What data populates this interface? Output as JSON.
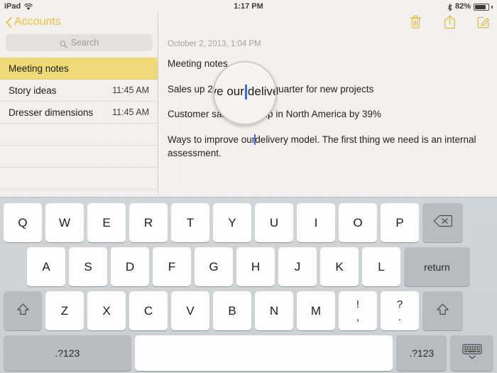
{
  "status_bar": {
    "device": "iPad",
    "wifi_icon": "wifi-icon",
    "time": "1:17 PM",
    "bluetooth_icon": "bluetooth-icon",
    "battery_percent": "82%",
    "battery_icon": "battery-icon"
  },
  "sidebar": {
    "back_label": "Accounts",
    "back_chevron_icon": "chevron-left-icon",
    "search": {
      "icon": "search-icon",
      "placeholder": "Search",
      "value": ""
    },
    "notes": [
      {
        "title": "Meeting notes",
        "time": "",
        "selected": true
      },
      {
        "title": "Story ideas",
        "time": "11:45 AM",
        "selected": false
      },
      {
        "title": "Dresser dimensions",
        "time": "11:45 AM",
        "selected": false
      }
    ],
    "empty_rows": 4
  },
  "note": {
    "toolbar": {
      "trash_icon": "trash-icon",
      "share_icon": "share-icon",
      "compose_icon": "compose-icon"
    },
    "date": "October 2, 2013, 1:04 PM",
    "title_line": "Meeting notes",
    "paragraphs": [
      "Sales up 20 percent this quarter for new projects",
      "Customer satisfaction up in North America by 39%",
      "Ways to improve our delivery model.  The first thing we need is an internal assessment."
    ],
    "body_line3_before_caret": "Ways to improve our",
    "body_line3_after_caret": "delivery model.  The first thing we need is an internal assessment.",
    "caret_color": "#3a6fe0"
  },
  "magnifier": {
    "text_before_caret": "ve our",
    "text_after_caret": "delive"
  },
  "keyboard": {
    "row1": [
      {
        "label": "Q",
        "type": "letter"
      },
      {
        "label": "W",
        "type": "letter"
      },
      {
        "label": "E",
        "type": "letter"
      },
      {
        "label": "R",
        "type": "letter"
      },
      {
        "label": "T",
        "type": "letter"
      },
      {
        "label": "Y",
        "type": "letter"
      },
      {
        "label": "U",
        "type": "letter"
      },
      {
        "label": "I",
        "type": "letter"
      },
      {
        "label": "O",
        "type": "letter"
      },
      {
        "label": "P",
        "type": "letter"
      },
      {
        "label": "",
        "type": "backspace",
        "icon": "backspace-icon"
      }
    ],
    "row2": [
      {
        "label": "A",
        "type": "letter"
      },
      {
        "label": "S",
        "type": "letter"
      },
      {
        "label": "D",
        "type": "letter"
      },
      {
        "label": "F",
        "type": "letter"
      },
      {
        "label": "G",
        "type": "letter"
      },
      {
        "label": "H",
        "type": "letter"
      },
      {
        "label": "J",
        "type": "letter"
      },
      {
        "label": "K",
        "type": "letter"
      },
      {
        "label": "L",
        "type": "letter"
      },
      {
        "label": "return",
        "type": "return"
      }
    ],
    "row3": [
      {
        "label": "",
        "type": "shift",
        "icon": "shift-icon"
      },
      {
        "label": "Z",
        "type": "letter"
      },
      {
        "label": "X",
        "type": "letter"
      },
      {
        "label": "C",
        "type": "letter"
      },
      {
        "label": "V",
        "type": "letter"
      },
      {
        "label": "B",
        "type": "letter"
      },
      {
        "label": "N",
        "type": "letter"
      },
      {
        "label": "M",
        "type": "letter"
      },
      {
        "label": "!",
        "sub": ",",
        "type": "dual"
      },
      {
        "label": "?",
        "sub": ".",
        "type": "dual"
      },
      {
        "label": "",
        "type": "shift",
        "icon": "shift-icon"
      }
    ],
    "row4": [
      {
        "label": ".?123",
        "type": "numeric-left"
      },
      {
        "label": "",
        "type": "space"
      },
      {
        "label": ".?123",
        "type": "numeric-right"
      },
      {
        "label": "",
        "type": "hide-keyboard",
        "icon": "hide-keyboard-icon"
      }
    ]
  },
  "colors": {
    "accent_yellow": "#e8c33d",
    "selected_row": "#f0d977",
    "caret_blue": "#3a6fe0",
    "keyboard_bg": "#d0d2d5",
    "key_white": "#fdfdfd",
    "key_gray": "#b9bcbf"
  }
}
